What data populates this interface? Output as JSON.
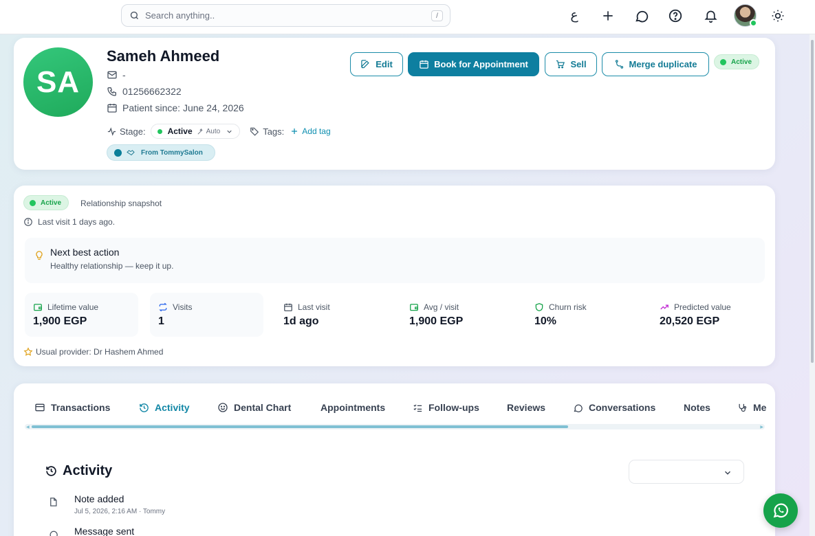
{
  "topbar": {
    "search_placeholder": "Search anything..",
    "search_shortcut": "/",
    "language_toggle": "ع",
    "icons": [
      "plus-icon",
      "chat-icon",
      "help-icon",
      "bell-icon",
      "sun-icon"
    ]
  },
  "patient": {
    "initials": "SA",
    "name": "Sameh Ahmeed",
    "email": "-",
    "phone": "01256662322",
    "since": "Patient since: June 24, 2026",
    "stage_label": "Stage:",
    "stage_value": "Active",
    "stage_mode": "Auto",
    "tags_label": "Tags:",
    "add_tag_label": "Add tag",
    "source": "From TommySalon"
  },
  "actions": {
    "edit": "Edit",
    "book": "Book for Appointment",
    "sell": "Sell",
    "merge": "Merge duplicate",
    "status": "Active"
  },
  "snapshot": {
    "status": "Active",
    "label": "Relationship snapshot",
    "last_visit_note": "Last visit 1 days ago.",
    "nba_title": "Next best action",
    "nba_text": "Healthy relationship — keep it up.",
    "metrics": [
      {
        "label": "Lifetime value",
        "value": "1,900 EGP"
      },
      {
        "label": "Visits",
        "value": "1"
      },
      {
        "label": "Last visit",
        "value": "1d ago"
      },
      {
        "label": "Avg / visit",
        "value": "1,900 EGP"
      },
      {
        "label": "Churn risk",
        "value": "10%"
      },
      {
        "label": "Predicted value",
        "value": "20,520 EGP"
      }
    ],
    "provider": "Usual provider: Dr Hashem Ahmed"
  },
  "tabs": [
    "Transactions",
    "Activity",
    "Dental Chart",
    "Appointments",
    "Follow-ups",
    "Reviews",
    "Conversations",
    "Notes",
    "Me"
  ],
  "active_tab": "Activity",
  "activity": {
    "title": "Activity",
    "items": [
      {
        "title": "Note added",
        "meta": "Jul 5, 2026, 2:16 AM · Tommy"
      },
      {
        "title": "Message sent",
        "meta": ""
      }
    ]
  },
  "colors": {
    "accent": "#0e7fa0",
    "success": "#22c55e",
    "whatsapp": "#16a34a"
  }
}
